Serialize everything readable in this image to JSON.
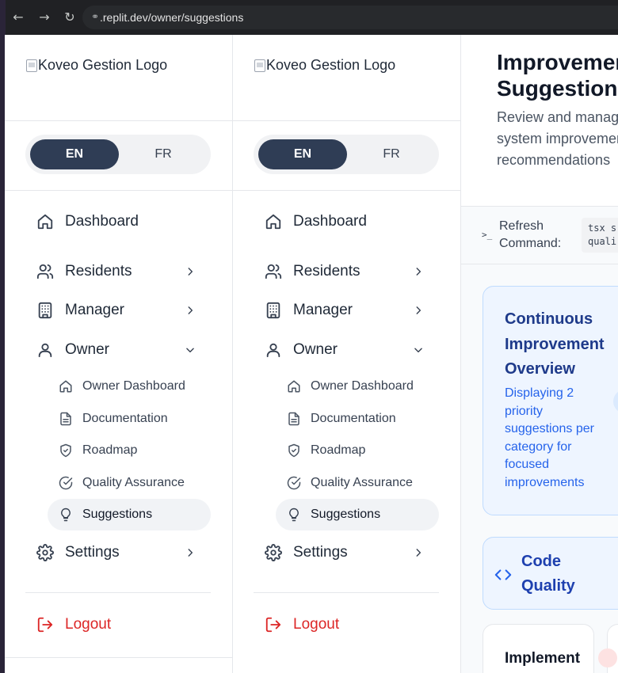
{
  "browser": {
    "url": ".replit.dev/owner/suggestions",
    "back_icon": "←",
    "forward_icon": "→",
    "reload_icon": "↻",
    "link_icon": "⚭"
  },
  "sidebar": {
    "logo_alt": "Koveo Gestion Logo",
    "lang": {
      "en": "EN",
      "fr": "FR",
      "active": "EN"
    },
    "nav": {
      "dashboard": "Dashboard",
      "residents": "Residents",
      "manager": "Manager",
      "owner": "Owner",
      "owner_items": [
        "Owner Dashboard",
        "Documentation",
        "Roadmap",
        "Quality Assurance",
        "Suggestions"
      ],
      "active_item": "Suggestions",
      "settings": "Settings",
      "logout": "Logout"
    }
  },
  "main": {
    "title": "Improvemen\nSuggestions",
    "subtitle": "Review and manag system improvement recommendations",
    "refresh_label": "Refresh Command:",
    "refresh_code": "tsx s\nquali",
    "overview_title": "Continuous Improvement Overview",
    "overview_desc": "Displaying 2 priority suggestions per category for focused improvements",
    "category_title": "Code Quality",
    "card_title": "Implement"
  },
  "colors": {
    "accent_dark": "#2f3d55",
    "logout_red": "#dc2626",
    "overview_blue": "#1e3a8a",
    "link_blue": "#2563eb"
  }
}
